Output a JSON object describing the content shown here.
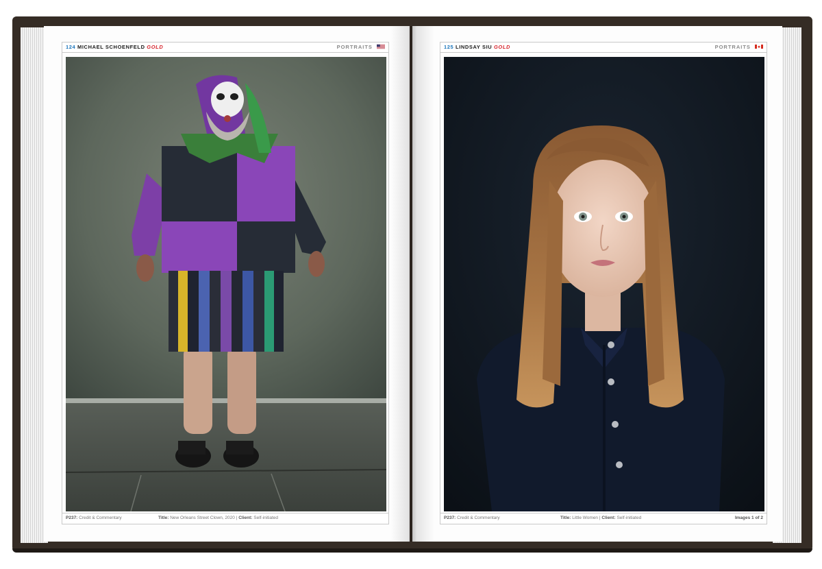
{
  "left_page": {
    "header": {
      "number": "124",
      "name": "MICHAEL SCHOENFELD",
      "award": "GOLD",
      "category": "PORTRAITS",
      "flag_icon": "us-flag-icon"
    },
    "photo": {
      "subject": "clown-portrait"
    },
    "footer": {
      "credit_ref": "P237:",
      "credit_text": "Credit & Commentary",
      "title_label": "Title:",
      "title_value": "New Orleans Street Clown, 2020",
      "sep": "|",
      "client_label": "Client:",
      "client_value": "Self-initiated"
    }
  },
  "right_page": {
    "header": {
      "number": "125",
      "name": "LINDSAY SIU",
      "award": "GOLD",
      "category": "PORTRAITS",
      "flag_icon": "canada-flag-icon"
    },
    "photo": {
      "subject": "girl-portrait"
    },
    "footer": {
      "credit_ref": "P237:",
      "credit_text": "Credit & Commentary",
      "title_label": "Title:",
      "title_value": "Little Women",
      "sep": "|",
      "client_label": "Client:",
      "client_value": "Self-initiated",
      "pagination": "Images 1 of 2"
    }
  },
  "colors": {
    "number_blue": "#1b75bb",
    "award_red": "#d7262e",
    "cover_brown": "#352c25"
  }
}
